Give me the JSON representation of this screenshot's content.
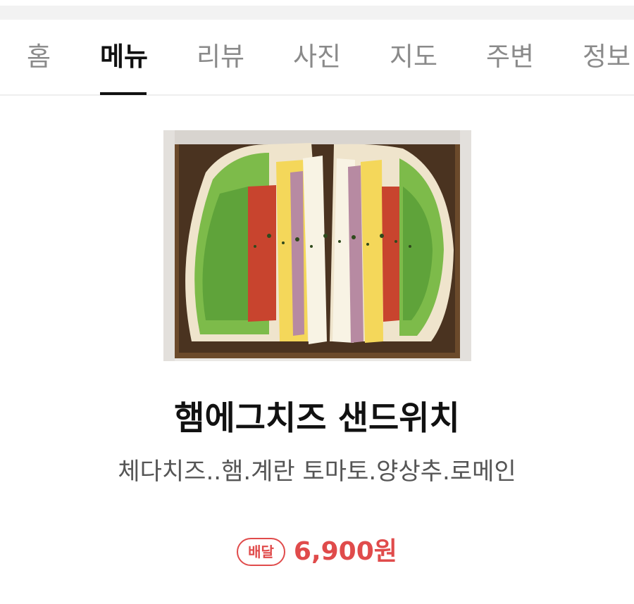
{
  "tabs": [
    {
      "label": "홈",
      "active": false
    },
    {
      "label": "메뉴",
      "active": true
    },
    {
      "label": "리뷰",
      "active": false
    },
    {
      "label": "사진",
      "active": false
    },
    {
      "label": "지도",
      "active": false
    },
    {
      "label": "주변",
      "active": false
    },
    {
      "label": "정보",
      "active": false
    }
  ],
  "menu_item": {
    "name": "햄에그치즈 샌드위치",
    "description": "체다치즈..햄.계란 토마토.양상추.로메인",
    "badge": "배달",
    "price": "6,900원",
    "image_semantic": "ham-egg-cheese-sandwich-photo"
  },
  "colors": {
    "accent": "#e04b4b",
    "active_tab": "#111111",
    "inactive_tab": "#8a8a8a",
    "description": "#555555"
  }
}
